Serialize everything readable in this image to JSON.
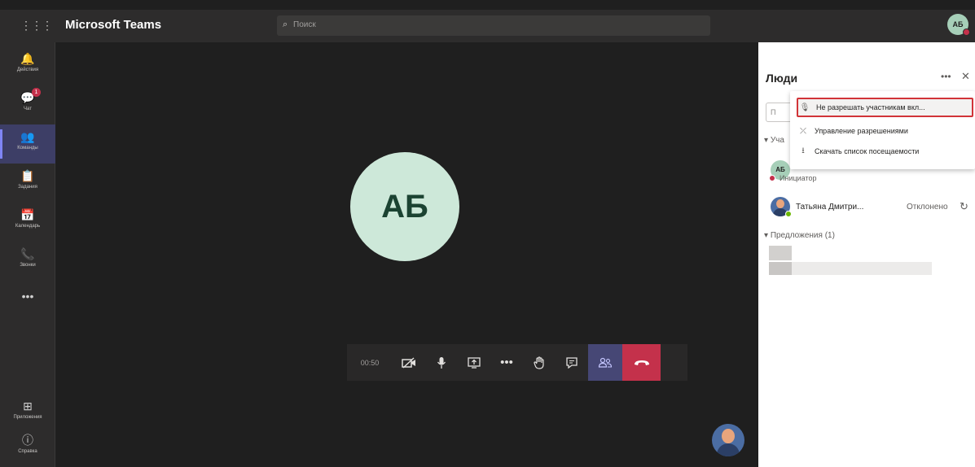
{
  "app": {
    "title": "Microsoft Teams",
    "waffle_icon": "app-launcher-icon"
  },
  "search": {
    "placeholder": "Поиск"
  },
  "profile": {
    "initials": "АБ",
    "status_color": "#c4314b"
  },
  "rail": {
    "items": [
      {
        "label": "Действия",
        "icon": "bell-icon",
        "glyph": "🔔"
      },
      {
        "label": "Чат",
        "icon": "chat-icon",
        "glyph": "💬",
        "badge": "1"
      },
      {
        "label": "Команды",
        "icon": "teams-icon",
        "glyph": "👥",
        "active": true
      },
      {
        "label": "Задания",
        "icon": "assignments-icon",
        "glyph": "📋"
      },
      {
        "label": "Календарь",
        "icon": "calendar-icon",
        "glyph": "📅"
      },
      {
        "label": "Звонки",
        "icon": "phone-icon",
        "glyph": "📞"
      },
      {
        "label": "",
        "icon": "more-icon",
        "glyph": "•••"
      }
    ],
    "bottom": [
      {
        "label": "Приложения",
        "icon": "apps-icon",
        "glyph": "⊞"
      },
      {
        "label": "Справка",
        "icon": "help-icon",
        "glyph": "ⓘ"
      }
    ]
  },
  "stage": {
    "participant_initials": "АБ",
    "avatar_color": "#cde8d9"
  },
  "controls": {
    "timer": "00:50",
    "buttons": [
      "camera-off-icon",
      "microphone-icon",
      "share-screen-icon",
      "more-actions-icon",
      "raise-hand-icon",
      "chat-icon",
      "participants-icon",
      "hang-up-icon"
    ],
    "hangup_color": "#c4314b",
    "participants_active_color": "#464775"
  },
  "people_panel": {
    "title": "Люди",
    "invite_placeholder": "П",
    "section_participants": "Уча",
    "participant_role": "Инициатор",
    "participant_initials": "АБ",
    "participant_name": "Татьяна Дмитри...",
    "participant_status": "Отклонено",
    "section_suggestions": "Предложения (1)"
  },
  "menu": {
    "items": [
      {
        "label": "Не разрешать участникам вкл...",
        "icon": "mic-block-icon",
        "highlighted": true
      },
      {
        "label": "Управление разрешениями",
        "icon": "permissions-icon"
      },
      {
        "label": "Скачать список посещаемости",
        "icon": "download-icon"
      }
    ]
  }
}
